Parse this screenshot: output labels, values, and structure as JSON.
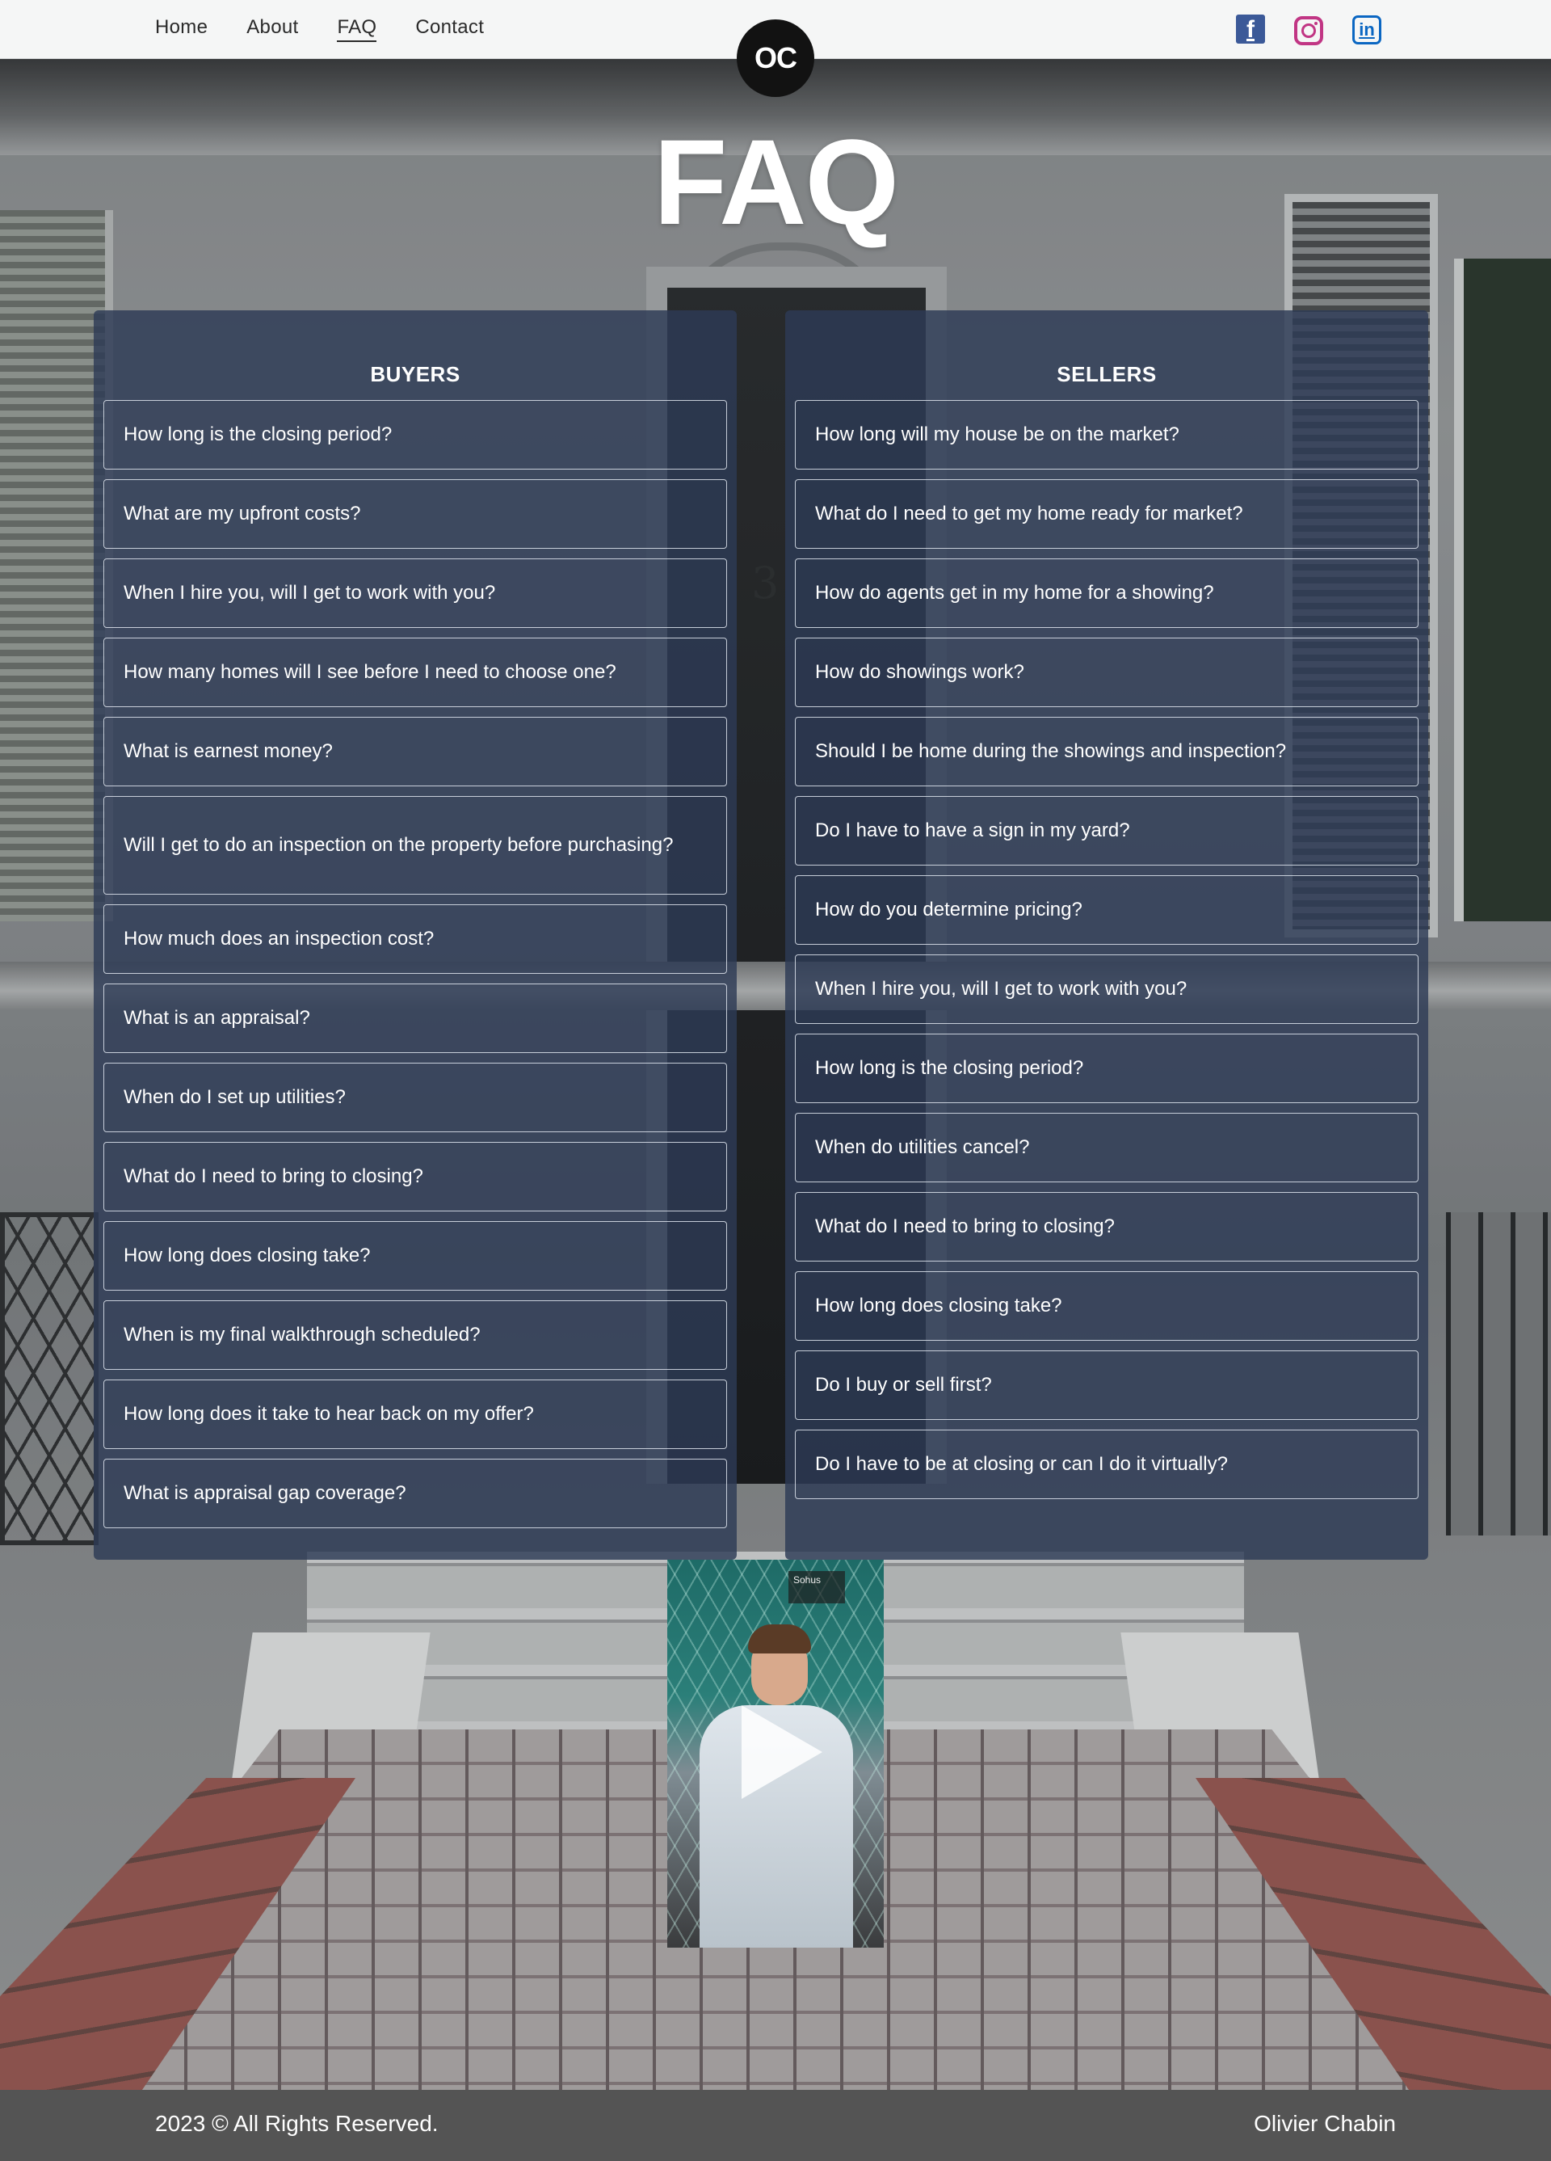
{
  "nav": {
    "items": [
      {
        "label": "Home"
      },
      {
        "label": "About"
      },
      {
        "label": "FAQ",
        "active": true
      },
      {
        "label": "Contact"
      }
    ],
    "logo_text": "OC",
    "social": [
      {
        "icon": "facebook-icon",
        "color": "#3b5998"
      },
      {
        "icon": "instagram-icon",
        "color": "#c13584"
      },
      {
        "icon": "linkedin-icon",
        "color": "#0a66c2"
      }
    ]
  },
  "page": {
    "title": "FAQ",
    "house_number": "3"
  },
  "buyers": {
    "heading": "BUYERS",
    "questions": [
      "How long is the closing period?",
      "What are my upfront costs?",
      "When I hire you, will I get to work with you?",
      "How many homes will I see before I need to choose one?",
      "What is earnest money?",
      "Will I get to do an inspection on the property before purchasing?",
      "How much does an inspection cost?",
      "What is an appraisal?",
      "When do I set up utilities?",
      "What do I need to bring to closing?",
      "How long does closing take?",
      "When is my final walkthrough scheduled?",
      "How long does it take to hear back on my offer?",
      "What is appraisal gap coverage?"
    ]
  },
  "sellers": {
    "heading": "SELLERS",
    "questions": [
      "How long will my house be on the market?",
      "What do I need to get my home ready for market?",
      "How do agents get in my home for a showing?",
      "How do showings work?",
      "Should I be home during the showings and inspection?",
      "Do I have to have a sign in my yard?",
      "How do you determine pricing?",
      "When I hire you, will I get to work with you?",
      "How long is the closing period?",
      "When do utilities cancel?",
      "What do I need to bring to closing?",
      "How long does closing take?",
      "Do I buy or sell first?",
      "Do I have to be at closing or can I do it virtually?"
    ]
  },
  "video": {
    "sign_text": "Sohus"
  },
  "footer": {
    "copyright": "2023 © All Rights Reserved.",
    "name": "Olivier Chabin"
  },
  "colors": {
    "panel": "#2d3a56",
    "footer": "#545454",
    "nav_bg": "#f5f6f6"
  }
}
